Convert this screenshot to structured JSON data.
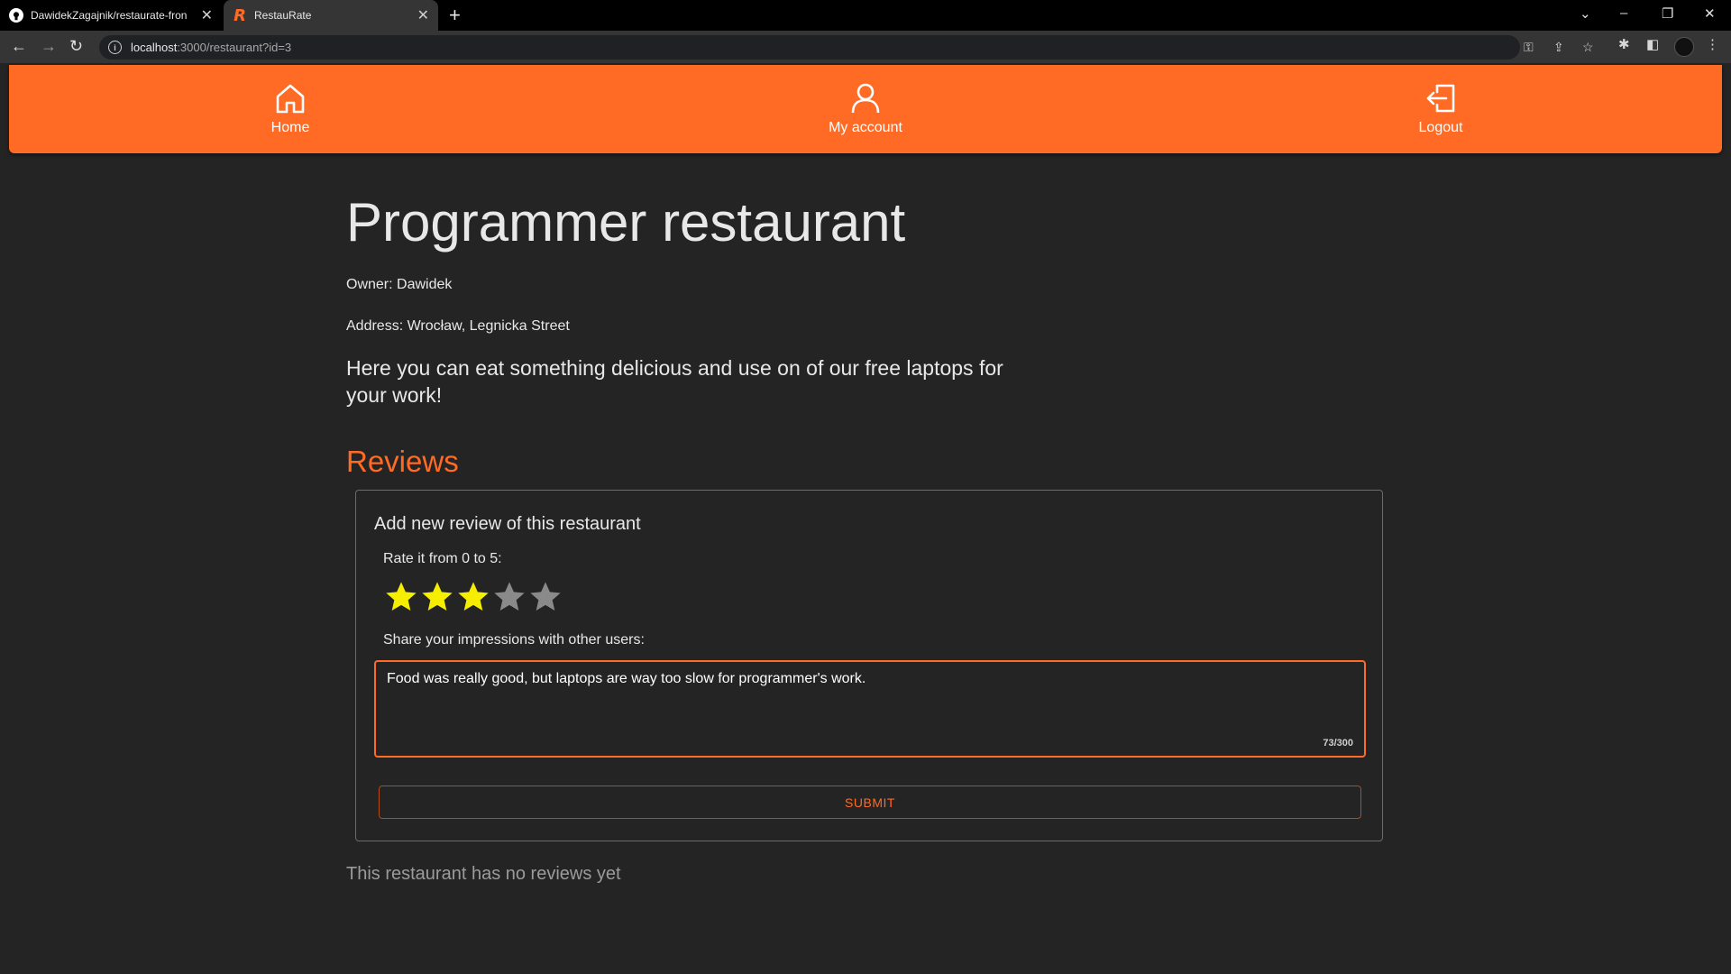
{
  "browser": {
    "tabs": [
      {
        "label": "DawidekZagajnik/restaurate-fron"
      },
      {
        "label": "RestauRate"
      }
    ],
    "url_host": "localhost",
    "url_rest": ":3000/restaurant?id=3"
  },
  "nav": {
    "home_label": "Home",
    "account_label": "My account",
    "logout_label": "Logout"
  },
  "restaurant": {
    "name": "Programmer restaurant",
    "owner": "Owner: Dawidek",
    "address": "Address: Wrocław, Legnicka Street",
    "description": "Here you can eat something delicious and use on of our free laptops for your work!"
  },
  "reviews": {
    "heading": "Reviews",
    "form": {
      "title": "Add new review of this restaurant",
      "rate_label": "Rate it from 0 to 5:",
      "rating": 3,
      "max_rating": 5,
      "impressions_label": "Share your impressions with other users:",
      "text_value": "Food was really good, but laptops are way too slow for programmer's work.",
      "char_counter": "73/300",
      "submit_label": "SUBMIT"
    },
    "empty_message": "This restaurant has no reviews yet"
  },
  "colors": {
    "accent": "#ff6a24",
    "background": "#242424",
    "star_filled": "#f5ee00",
    "star_empty": "#8a8a8a"
  }
}
